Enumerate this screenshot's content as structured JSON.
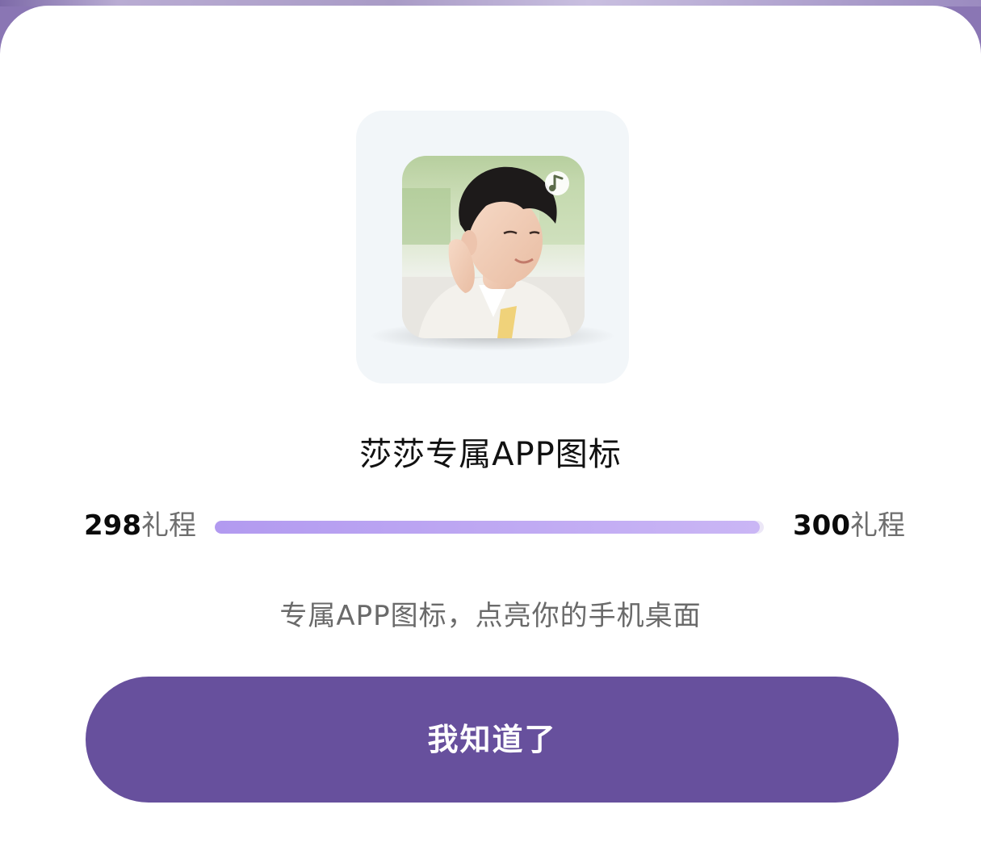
{
  "dialog": {
    "title": "莎莎专属APP图标",
    "progress": {
      "current_value": "298",
      "current_unit": "礼程",
      "target_value": "300",
      "target_unit": "礼程",
      "fraction": 0.993
    },
    "description": "专属APP图标，点亮你的手机桌面",
    "button_label": "我知道了",
    "icon": "app-icon-portrait-with-music-badge"
  },
  "colors": {
    "button": "#67509d",
    "progress_fill": "#b29af0",
    "progress_track": "#ece7f7",
    "icon_card_bg": "#f2f6f9",
    "backdrop": "#8a76b4"
  }
}
